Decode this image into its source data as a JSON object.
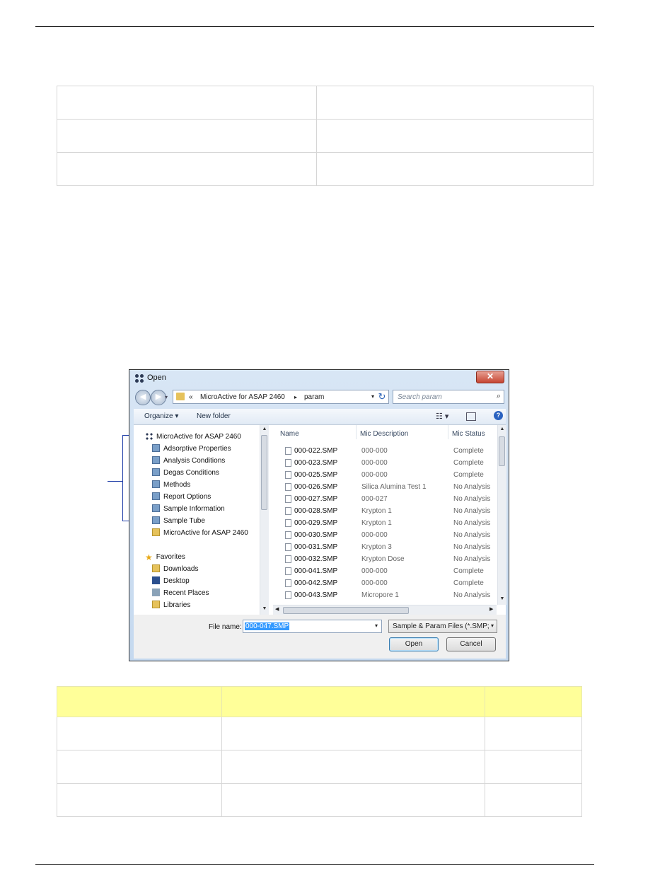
{
  "dialog": {
    "title": "Open",
    "close_label": "✕",
    "breadcrumb": [
      "«",
      "MicroActive for ASAP 2460",
      "▸",
      "param"
    ],
    "search_placeholder": "Search param",
    "toolbar": {
      "organize": "Organize ▾",
      "new_folder": "New folder",
      "view_icon": "☷ ▾",
      "help": "?"
    },
    "nav_items": [
      {
        "label": "MicroActive for ASAP 2460",
        "icon": "app-icon"
      },
      {
        "label": "Adsorptive Properties",
        "icon": "param-file-icon"
      },
      {
        "label": "Analysis Conditions",
        "icon": "param-file-icon"
      },
      {
        "label": "Degas Conditions",
        "icon": "param-file-icon"
      },
      {
        "label": "Methods",
        "icon": "param-file-icon"
      },
      {
        "label": "Report Options",
        "icon": "param-file-icon"
      },
      {
        "label": "Sample Information",
        "icon": "param-file-icon"
      },
      {
        "label": "Sample Tube",
        "icon": "param-file-icon"
      },
      {
        "label": "MicroActive for ASAP 2460",
        "icon": "folder-icon"
      },
      {
        "label": "Favorites",
        "icon": "star-icon"
      },
      {
        "label": "Downloads",
        "icon": "downloads-icon"
      },
      {
        "label": "Desktop",
        "icon": "desktop-icon"
      },
      {
        "label": "Recent Places",
        "icon": "recent-places-icon"
      },
      {
        "label": "Libraries",
        "icon": "libraries-icon"
      }
    ],
    "columns": [
      "Name",
      "Mic Description",
      "Mic Status"
    ],
    "files": [
      {
        "name": "000-022.SMP",
        "desc": "000-000",
        "status": "Complete"
      },
      {
        "name": "000-023.SMP",
        "desc": "000-000",
        "status": "Complete"
      },
      {
        "name": "000-025.SMP",
        "desc": "000-000",
        "status": "Complete"
      },
      {
        "name": "000-026.SMP",
        "desc": "Silica Alumina Test 1",
        "status": "No Analysis"
      },
      {
        "name": "000-027.SMP",
        "desc": "000-027",
        "status": "No Analysis"
      },
      {
        "name": "000-028.SMP",
        "desc": "Krypton 1",
        "status": "No Analysis"
      },
      {
        "name": "000-029.SMP",
        "desc": "Krypton 1",
        "status": "No Analysis"
      },
      {
        "name": "000-030.SMP",
        "desc": "000-000",
        "status": "No Analysis"
      },
      {
        "name": "000-031.SMP",
        "desc": "Krypton 3",
        "status": "No Analysis"
      },
      {
        "name": "000-032.SMP",
        "desc": "Krypton Dose",
        "status": "No Analysis"
      },
      {
        "name": "000-041.SMP",
        "desc": "000-000",
        "status": "Complete"
      },
      {
        "name": "000-042.SMP",
        "desc": "000-000",
        "status": "Complete"
      },
      {
        "name": "000-043.SMP",
        "desc": "Micropore 1",
        "status": "No Analysis"
      }
    ],
    "file_name_label": "File name:",
    "file_name_value": "000-047.SMP",
    "file_type": "Sample & Param Files  (*.SMP;",
    "open_label": "Open",
    "cancel_label": "Cancel"
  }
}
